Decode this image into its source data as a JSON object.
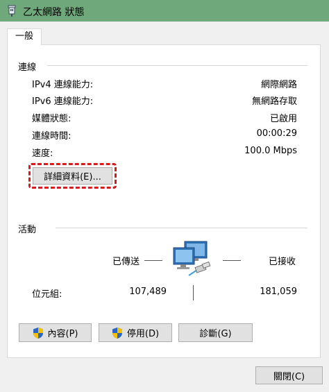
{
  "window": {
    "title": "乙太網路 狀態"
  },
  "tabs": [
    {
      "label": "一般"
    }
  ],
  "connection": {
    "heading": "連線",
    "rows": [
      {
        "label": "IPv4 連線能力:",
        "value": "網際網路"
      },
      {
        "label": "IPv6 連線能力:",
        "value": "無網路存取"
      },
      {
        "label": "媒體狀態:",
        "value": "已啟用"
      },
      {
        "label": "連線時間:",
        "value": "00:00:29"
      },
      {
        "label": "速度:",
        "value": "100.0 Mbps"
      }
    ],
    "details_button": "詳細資料(E)..."
  },
  "activity": {
    "heading": "活動",
    "sent_label": "已傳送",
    "received_label": "已接收",
    "bytes_label": "位元組:",
    "bytes_sent": "107,489",
    "bytes_received": "181,059"
  },
  "buttons": {
    "properties": "內容(P)",
    "disable": "停用(D)",
    "diagnose": "診斷(G)",
    "close": "關閉(C)"
  },
  "icons": {
    "title": "network-adapter-icon",
    "activity": "network-computers-icon",
    "shield": "uac-shield-icon"
  },
  "colors": {
    "titlebar": "#6fa87b",
    "highlight": "#d8191e"
  }
}
